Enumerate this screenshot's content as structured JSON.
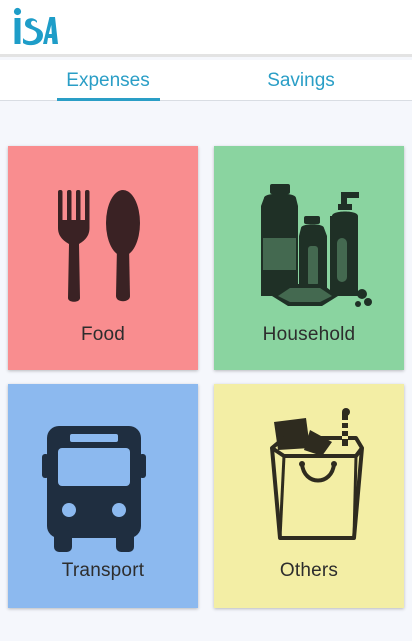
{
  "header": {
    "logo_text": "iSA"
  },
  "tabs": [
    {
      "label": "Expenses",
      "active": true
    },
    {
      "label": "Savings",
      "active": false
    }
  ],
  "categories": [
    {
      "label": "Food",
      "icon": "fork-spoon-icon",
      "color": "#f98d8f"
    },
    {
      "label": "Household",
      "icon": "household-products-icon",
      "color": "#8ad4a0"
    },
    {
      "label": "Transport",
      "icon": "bus-icon",
      "color": "#8cb9ef"
    },
    {
      "label": "Others",
      "icon": "shopping-bag-icon",
      "color": "#f3eea5"
    }
  ],
  "colors": {
    "accent": "#2a9ec6",
    "icon_food": "#3a2224",
    "icon_household": "#1f3026",
    "icon_transport": "#1f2e40",
    "icon_others": "#2e2b1f"
  }
}
